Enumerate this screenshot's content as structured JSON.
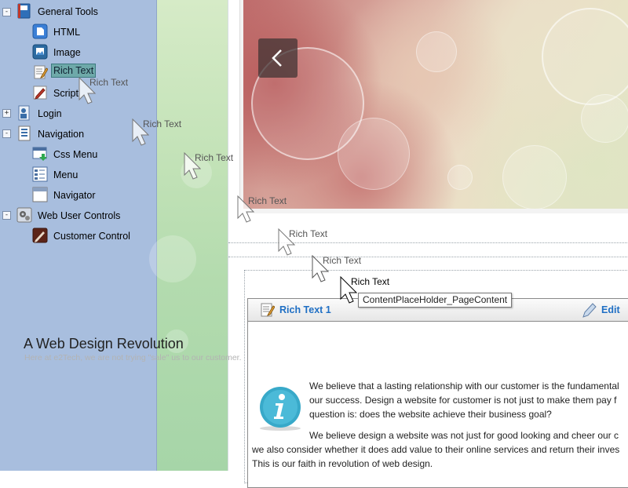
{
  "toolbox": {
    "groups": [
      {
        "label": "General Tools",
        "expander": "-"
      },
      {
        "label": "Login",
        "expander": "+"
      },
      {
        "label": "Navigation",
        "expander": "-"
      },
      {
        "label": "Web User Controls",
        "expander": "-"
      }
    ],
    "items": {
      "html": "HTML",
      "image": "Image",
      "rich_text": "Rich Text",
      "script": "Script",
      "css_menu": "Css Menu",
      "menu": "Menu",
      "navigator": "Navigator",
      "customer_control": "Customer Control"
    },
    "selected_item": "Rich Text"
  },
  "drag": {
    "ghost_label": "Rich Text",
    "tooltip": "ContentPlaceHolder_PageContent"
  },
  "slider": {
    "prev_icon": "chevron-left-icon"
  },
  "webpart": {
    "title": "Rich Text 1",
    "edit_label": "Edit",
    "icon": "rich-text-icon",
    "edit_icon": "pencil-icon"
  },
  "article": {
    "title": "A Web Design Revolution",
    "subtitle": "Here at e2Tech, we are not trying \"sale\" us to our customer.",
    "info_icon": "info-icon",
    "paragraph1": [
      "We believe that a lasting relationship with our customer is the fundamental",
      "our success. Design a website for customer is not just to make them pay f",
      "question is: does the website achieve their business goal?"
    ],
    "paragraph2": [
      "We believe design a website was not just for good looking and cheer our c",
      "we also consider whether it does add value to their online services and return their inves",
      "This is our faith in revolution of web design."
    ]
  },
  "colors": {
    "sidebar_bg": "#a8bede",
    "link_blue": "#1f6fc4",
    "selection": "#6ea9a9"
  }
}
